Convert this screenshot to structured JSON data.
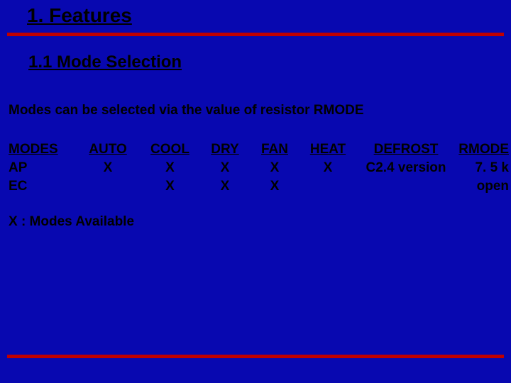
{
  "title": "1. Features",
  "subtitle": "1.1 Mode Selection",
  "intro": "Modes can be selected via the value of resistor RMODE",
  "headers": {
    "modes": "MODES",
    "auto": "AUTO",
    "cool": "COOL",
    "dry": "DRY",
    "fan": "FAN",
    "heat": "HEAT",
    "defrost": "DEFROST",
    "rmode": "RMODE"
  },
  "rows": [
    {
      "name": "AP",
      "auto": "X",
      "cool": "X",
      "dry": "X",
      "fan": "X",
      "heat": "X",
      "defrost": "C2.4 version",
      "rmode": "7. 5 k"
    },
    {
      "name": "EC",
      "auto": "",
      "cool": "X",
      "dry": "X",
      "fan": "X",
      "heat": "",
      "defrost": "",
      "rmode": "open"
    }
  ],
  "legend": "X  : Modes Available"
}
